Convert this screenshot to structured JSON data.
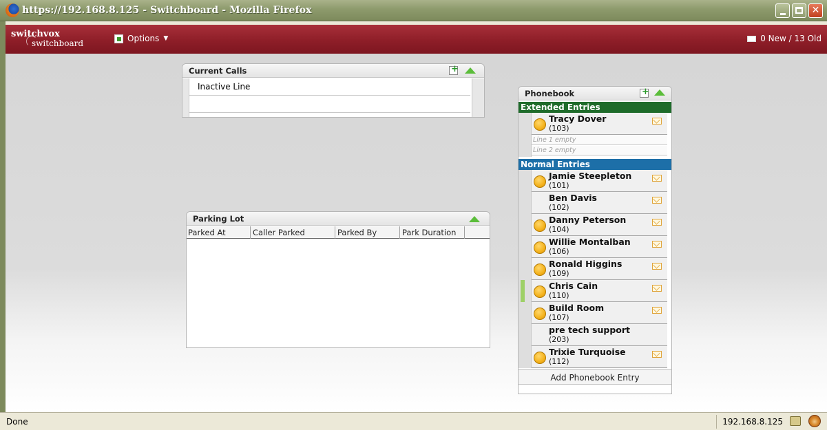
{
  "window": {
    "title": "https://192.168.8.125 - Switchboard - Mozilla Firefox"
  },
  "header": {
    "logo_top": "switchvox",
    "logo_bottom": "switchboard",
    "options_label": "Options",
    "messages_label": "0 New / 13 Old"
  },
  "current_calls": {
    "title": "Current Calls",
    "lines": [
      "Inactive Line",
      ""
    ]
  },
  "parking_lot": {
    "title": "Parking Lot",
    "columns": [
      "Parked At",
      "Caller Parked",
      "Parked By",
      "Park Duration"
    ]
  },
  "phonebook": {
    "title": "Phonebook",
    "extended_label": "Extended Entries",
    "normal_label": "Normal Entries",
    "extended": [
      {
        "name": "Tracy Dover",
        "ext": "(103)",
        "line1": "Line 1 empty",
        "line2": "Line 2 empty"
      }
    ],
    "normal": [
      {
        "name": "Jamie Steepleton",
        "ext": "(101)"
      },
      {
        "name": "Ben Davis",
        "ext": "(102)"
      },
      {
        "name": "Danny Peterson",
        "ext": "(104)"
      },
      {
        "name": "Willie Montalban",
        "ext": "(106)"
      },
      {
        "name": "Ronald Higgins",
        "ext": "(109)"
      },
      {
        "name": "Chris Cain",
        "ext": "(110)"
      },
      {
        "name": "Build Room",
        "ext": "(107)"
      },
      {
        "name": "pre tech support",
        "ext": "(203)"
      },
      {
        "name": "Trixie Turquoise",
        "ext": "(112)"
      }
    ],
    "add_entry_label": "Add Phonebook Entry"
  },
  "statusbar": {
    "status_text": "Done",
    "host": "192.168.8.125"
  },
  "colors": {
    "header_red": "#8e1e28",
    "extended_green": "#1e6b2a",
    "normal_blue": "#1d6fa8"
  }
}
